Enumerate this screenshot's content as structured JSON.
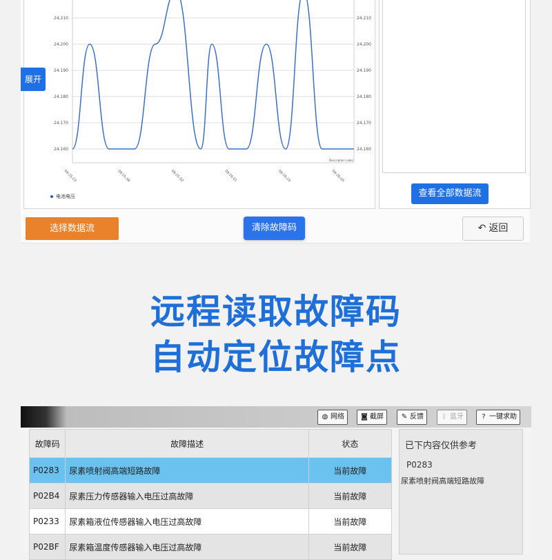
{
  "chart_screen": {
    "expand_label": "展开",
    "view_all_label": "查看全部数据流",
    "select_stream_label": "选择数据流",
    "clear_codes_label": "清除故障码",
    "back_label": "返回",
    "back_icon": "undo-arrow-icon",
    "colors": {
      "line": "#3a6fc4",
      "accent_blue": "#1f6fe5",
      "accent_orange": "#e9822b"
    }
  },
  "chart_data": {
    "type": "line",
    "series": [
      {
        "name": "电池电压",
        "values": [
          24.16,
          24.2,
          24.16,
          24.16,
          24.2,
          24.22,
          24.16,
          24.2,
          24.16,
          24.16,
          24.2,
          24.16,
          24.22,
          24.16,
          24.16
        ]
      }
    ],
    "x": [
      "09:25:23",
      "09:25:38",
      "09:25:52",
      "09:26:01",
      "09:26:10",
      "09:26:20"
    ],
    "y_ticks": [
      "24.210",
      "24.200",
      "24.190",
      "24.180",
      "24.170",
      "24.160"
    ],
    "ylim": [
      24.16,
      24.22
    ],
    "description_label": "Description Label",
    "legend": "bottom-left",
    "grid": true
  },
  "headline": {
    "line1": "远程读取故障码",
    "line2": "自动定位故障点"
  },
  "fault_screen": {
    "toolbar": [
      {
        "icon": "globe-icon",
        "label": "网络"
      },
      {
        "icon": "camera-icon",
        "label": "截屏"
      },
      {
        "icon": "edit-icon",
        "label": "反馈"
      },
      {
        "icon": "bluetooth-icon",
        "label": "蓝牙"
      },
      {
        "icon": "help-icon",
        "label": "一键求助"
      }
    ],
    "headers": {
      "code": "故障码",
      "desc": "故障描述",
      "status": "状态"
    },
    "rows": [
      {
        "code": "P0283",
        "desc": "尿素喷射阀高端短路故障",
        "status": "当前故障"
      },
      {
        "code": "P02B4",
        "desc": "尿素压力传感器输入电压过高故障",
        "status": "当前故障"
      },
      {
        "code": "P0233",
        "desc": "尿素箱液位传感器输入电压过高故障",
        "status": "当前故障"
      },
      {
        "code": "P02BF",
        "desc": "尿素箱温度传感器输入电压过高故障",
        "status": "当前故障"
      }
    ],
    "reference": {
      "title": "已下内容仅供参考",
      "code": "P0283",
      "desc": "尿素喷射阀高端短路故障"
    }
  }
}
